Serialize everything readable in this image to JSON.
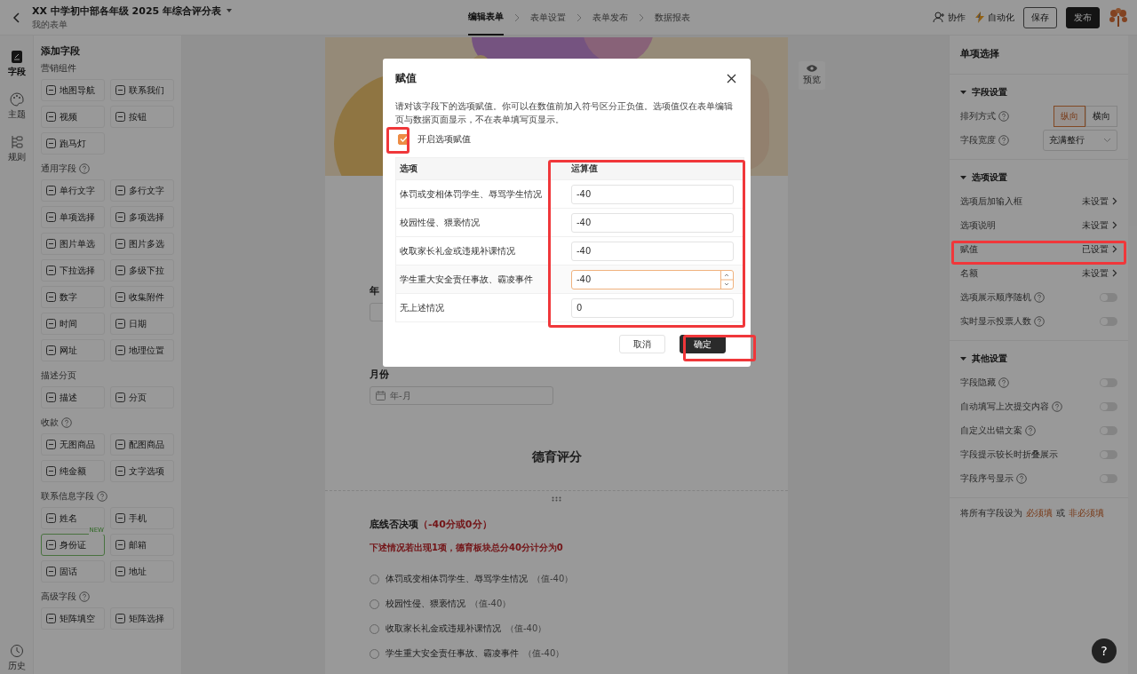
{
  "header": {
    "title": "XX 中学初中部各年级 2025 年综合评分表",
    "subtitle": "我的表单",
    "steps": [
      {
        "label": "编辑表单",
        "selected": true
      },
      {
        "label": "表单设置",
        "selected": false
      },
      {
        "label": "表单发布",
        "selected": false
      },
      {
        "label": "数据报表",
        "selected": false
      }
    ],
    "actions": [
      {
        "kind": "collab",
        "label": "协作"
      },
      {
        "kind": "auto",
        "label": "自动化"
      },
      {
        "kind": "outline",
        "label": "保存"
      },
      {
        "kind": "primary",
        "label": "发布"
      }
    ]
  },
  "rail": [
    {
      "label": "字段",
      "selected": true
    },
    {
      "label": "主题",
      "selected": false
    },
    {
      "label": "规则",
      "selected": false
    },
    {
      "label": "历史",
      "selected": false
    }
  ],
  "field_panel": {
    "title": "添加字段",
    "groups": [
      {
        "title": "营销组件",
        "help": false,
        "items": [
          {
            "label": "地图导航"
          },
          {
            "label": "联系我们"
          },
          {
            "label": "视频"
          },
          {
            "label": "按钮"
          },
          {
            "label": "跑马灯"
          }
        ]
      },
      {
        "title": "通用字段",
        "help": true,
        "items": [
          {
            "label": "单行文字"
          },
          {
            "label": "多行文字"
          },
          {
            "label": "单项选择"
          },
          {
            "label": "多项选择"
          },
          {
            "label": "图片单选"
          },
          {
            "label": "图片多选"
          },
          {
            "label": "下拉选择"
          },
          {
            "label": "多级下拉"
          },
          {
            "label": "数字"
          },
          {
            "label": "收集附件"
          },
          {
            "label": "时间"
          },
          {
            "label": "日期"
          },
          {
            "label": "网址"
          },
          {
            "label": "地理位置"
          }
        ]
      },
      {
        "title": "描述分页",
        "help": false,
        "items": [
          {
            "label": "描述"
          },
          {
            "label": "分页"
          }
        ]
      },
      {
        "title": "收款",
        "help": true,
        "items": [
          {
            "label": "无图商品"
          },
          {
            "label": "配图商品"
          },
          {
            "label": "纯金额"
          },
          {
            "label": "文字选项"
          }
        ]
      },
      {
        "title": "联系信息字段",
        "help": true,
        "items": [
          {
            "label": "姓名"
          },
          {
            "label": "手机"
          },
          {
            "label": "身份证",
            "badge": "NEW"
          },
          {
            "label": "邮箱"
          },
          {
            "label": "固话"
          },
          {
            "label": "地址"
          }
        ]
      },
      {
        "title": "高级字段",
        "help": true,
        "items": [
          {
            "label": "矩阵填空"
          },
          {
            "label": "矩阵选择"
          }
        ]
      }
    ]
  },
  "canvas": {
    "preview": "预览",
    "year_label": "年",
    "month_label": "月份",
    "month_placeholder": "年-月",
    "section_title": "德育评分",
    "question": {
      "title": "底线否决项",
      "score": "（-40分或0分）",
      "note": "下述情况若出现1项，德育板块总分40分计分为0",
      "options": [
        {
          "label": "体罚或变相体罚学生、辱骂学生情况",
          "value": "（值-40）",
          "selected": false
        },
        {
          "label": "校园性侵、猥亵情况",
          "value": "（值-40）",
          "selected": false
        },
        {
          "label": "收取家长礼金或违规补课情况",
          "value": "（值-40）",
          "selected": false
        },
        {
          "label": "学生重大安全责任事故、霸凌事件",
          "value": "（值-40）",
          "selected": false
        }
      ]
    }
  },
  "help_button": "?",
  "modal": {
    "title": "赋值",
    "description": "请对该字段下的选项赋值。你可以在数值前加入符号区分正负值。选项值仅在表单编辑页与数据页面显示，不在表单填写页显示。",
    "enable": {
      "label": "开启选项赋值",
      "checked": true
    },
    "columns": [
      "选项",
      "运算值"
    ],
    "rows": [
      {
        "option": "体罚或变相体罚学生、辱骂学生情况",
        "value": "-40",
        "focused": false
      },
      {
        "option": "校园性侵、猥亵情况",
        "value": "-40",
        "focused": false
      },
      {
        "option": "收取家长礼金或违规补课情况",
        "value": "-40",
        "focused": false
      },
      {
        "option": "学生重大安全责任事故、霸凌事件",
        "value": "-40",
        "focused": true
      },
      {
        "option": "无上述情况",
        "value": "0",
        "focused": false
      }
    ],
    "buttons": [
      {
        "kind": "cancel",
        "label": "取消"
      },
      {
        "kind": "confirm",
        "label": "确定"
      }
    ]
  },
  "settings": {
    "title": "单项选择",
    "sections": [
      {
        "title": "字段设置",
        "expanded": true,
        "rows": [
          {
            "kind": "segmented",
            "label": "排列方式",
            "help": true,
            "options": [
              {
                "label": "纵向",
                "selected": true
              },
              {
                "label": "横向",
                "selected": false
              }
            ]
          },
          {
            "kind": "select",
            "label": "字段宽度",
            "help": true,
            "value": "充满整行"
          }
        ]
      },
      {
        "title": "选项设置",
        "expanded": true,
        "rows": [
          {
            "kind": "link",
            "label": "选项后加输入框",
            "help": false,
            "value": "未设置"
          },
          {
            "kind": "link",
            "label": "选项说明",
            "help": false,
            "value": "未设置"
          },
          {
            "kind": "link",
            "label": "赋值",
            "help": false,
            "value": "已设置"
          },
          {
            "kind": "link",
            "label": "名额",
            "help": false,
            "value": "未设置"
          },
          {
            "kind": "toggle",
            "label": "选项展示顺序随机",
            "help": true,
            "on": false
          },
          {
            "kind": "toggle",
            "label": "实时显示投票人数",
            "help": true,
            "on": false
          }
        ]
      },
      {
        "title": "其他设置",
        "expanded": true,
        "rows": [
          {
            "kind": "toggle",
            "label": "字段隐藏",
            "help": true,
            "on": false
          },
          {
            "kind": "toggle",
            "label": "自动填写上次提交内容",
            "help": true,
            "on": false
          },
          {
            "kind": "toggle",
            "label": "自定义出错文案",
            "help": true,
            "on": false
          },
          {
            "kind": "toggle",
            "label": "字段提示较长时折叠展示",
            "help": false,
            "on": false
          },
          {
            "kind": "toggle",
            "label": "字段序号显示",
            "help": true,
            "on": false
          }
        ]
      }
    ],
    "footer": {
      "prefix": "将所有字段设为",
      "required": "必须填",
      "joiner": "或",
      "optional": "非必须填"
    }
  }
}
